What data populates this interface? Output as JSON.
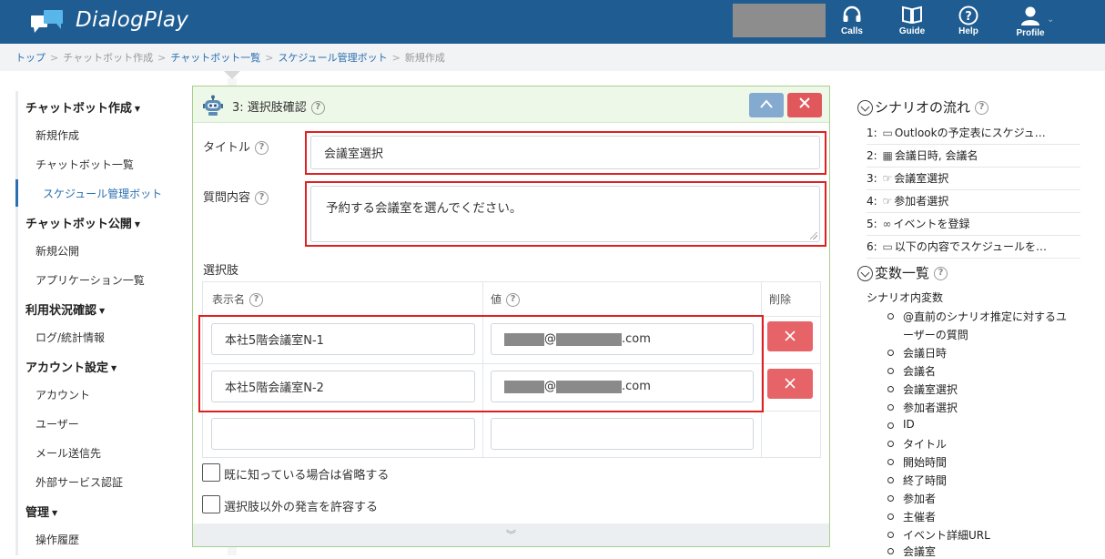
{
  "app": {
    "name": "DialogPlay",
    "nav": {
      "calls": "Calls",
      "guide": "Guide",
      "help": "Help",
      "profile": "Profile"
    }
  },
  "breadcrumb": {
    "items": [
      "トップ",
      "チャットボット作成",
      "チャットボット一覧",
      "スケジュール管理ボット",
      "新規作成"
    ]
  },
  "sidebar": {
    "groups": [
      {
        "label": "チャットボット作成",
        "items": [
          "新規作成",
          "チャットボット一覧",
          "スケジュール管理ボット"
        ]
      },
      {
        "label": "チャットボット公開",
        "items": [
          "新規公開",
          "アプリケーション一覧"
        ]
      },
      {
        "label": "利用状況確認",
        "items": [
          "ログ/統計情報"
        ]
      },
      {
        "label": "アカウント設定",
        "items": [
          "アカウント",
          "ユーザー",
          "メール送信先",
          "外部サービス認証"
        ]
      },
      {
        "label": "管理",
        "items": [
          "操作履歴"
        ]
      }
    ]
  },
  "panel": {
    "title": "3: 選択肢確認",
    "title_label": "タイトル",
    "title_value": "会議室選択",
    "question_label": "質問内容",
    "question_value": "予約する会議室を選んでください。",
    "choices_label": "選択肢",
    "col_display": "表示名",
    "col_value": "値",
    "col_delete": "削除",
    "rows": [
      {
        "display": "本社5階会議室N-1",
        "value_suffix": ".com"
      },
      {
        "display": "本社5階会議室N-2",
        "value_suffix": ".com"
      },
      {
        "display": "",
        "value_suffix": ""
      }
    ],
    "at_sign": "@",
    "skip_if_known": "既に知っている場合は省略する",
    "allow_other": "選択肢以外の発言を許容する"
  },
  "flow": {
    "heading": "シナリオの流れ",
    "items": [
      {
        "num": "1:",
        "icon": "speech-bubble",
        "text": "Outlookの予定表にスケジュ…"
      },
      {
        "num": "2:",
        "icon": "keyboard",
        "text": "会議日時, 会議名"
      },
      {
        "num": "3:",
        "icon": "hand-pointer",
        "text": "会議室選択"
      },
      {
        "num": "4:",
        "icon": "hand-pointer",
        "text": "参加者選択"
      },
      {
        "num": "5:",
        "icon": "link",
        "text": "イベントを登録"
      },
      {
        "num": "6:",
        "icon": "speech-bubble",
        "text": "以下の内容でスケジュールを…"
      }
    ]
  },
  "variables": {
    "heading": "変数一覧",
    "root": "シナリオ内変数",
    "items": [
      "@直前のシナリオ推定に対するユ",
      "ーザーの質問",
      "会議日時",
      "会議名",
      "会議室選択",
      "参加者選択",
      "ID",
      "タイトル",
      "開始時間",
      "終了時間",
      "参加者",
      "主催者",
      "イベント詳細URL",
      "会議室"
    ]
  },
  "colors": {
    "header": "#1f5c91",
    "accent": "#2a6fb0",
    "danger": "#e0575c",
    "highlight": "#e02020"
  }
}
